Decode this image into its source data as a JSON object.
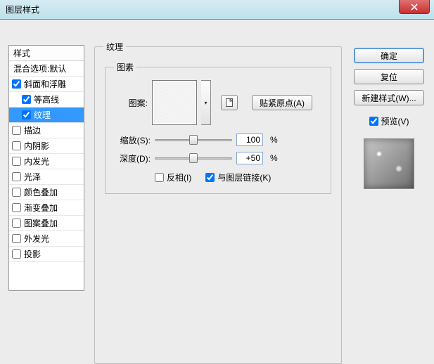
{
  "window": {
    "title": "图层样式"
  },
  "styles": {
    "header": "样式",
    "blend": "混合选项:默认",
    "items": [
      {
        "label": "斜面和浮雕",
        "checked": true,
        "indent": false
      },
      {
        "label": "等高线",
        "checked": true,
        "indent": true
      },
      {
        "label": "纹理",
        "checked": true,
        "indent": true,
        "selected": true
      },
      {
        "label": "描边",
        "checked": false,
        "indent": false
      },
      {
        "label": "内阴影",
        "checked": false,
        "indent": false
      },
      {
        "label": "内发光",
        "checked": false,
        "indent": false
      },
      {
        "label": "光泽",
        "checked": false,
        "indent": false
      },
      {
        "label": "颜色叠加",
        "checked": false,
        "indent": false
      },
      {
        "label": "渐变叠加",
        "checked": false,
        "indent": false
      },
      {
        "label": "图案叠加",
        "checked": false,
        "indent": false
      },
      {
        "label": "外发光",
        "checked": false,
        "indent": false
      },
      {
        "label": "投影",
        "checked": false,
        "indent": false
      }
    ]
  },
  "main": {
    "groupTitle": "纹理",
    "patternGroup": "图素",
    "patternLabel": "图案:",
    "snapOrigin": "贴紧原点(A)",
    "scale": {
      "label": "缩放(S):",
      "value": "100",
      "unit": "%",
      "pos": 50
    },
    "depth": {
      "label": "深度(D):",
      "value": "+50",
      "unit": "%",
      "pos": 50
    },
    "invert": {
      "label": "反相(I)",
      "checked": false
    },
    "linkLayer": {
      "label": "与图层链接(K)",
      "checked": true
    }
  },
  "right": {
    "ok": "确定",
    "cancel": "复位",
    "newStyle": "新建样式(W)...",
    "preview": {
      "label": "预览(V)",
      "checked": true
    }
  }
}
